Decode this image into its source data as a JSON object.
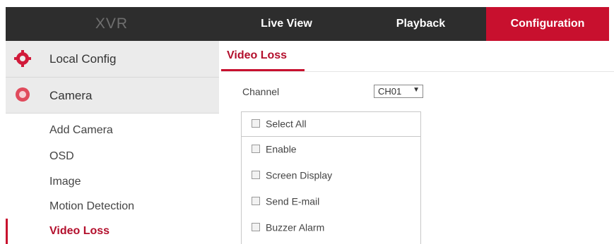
{
  "header": {
    "logo": "XVR",
    "nav": [
      "Live View",
      "Playback",
      "Configuration"
    ],
    "active_nav": "Configuration",
    "accent_color": "#c8102e",
    "bar_color": "#2d2d2d"
  },
  "sidebar": {
    "local_config": {
      "label": "Local Config",
      "icon": "gear-icon"
    },
    "camera": {
      "label": "Camera",
      "icon": "camera-icon"
    },
    "items": [
      "Add Camera",
      "OSD",
      "Image",
      "Motion Detection",
      "Video Loss"
    ],
    "active_item": "Video Loss"
  },
  "main": {
    "title": "Video Loss",
    "channel_label": "Channel",
    "channel_value": "CH01",
    "checkboxes": [
      "Select All",
      "Enable",
      "Screen Display",
      "Send E-mail",
      "Buzzer Alarm"
    ]
  }
}
